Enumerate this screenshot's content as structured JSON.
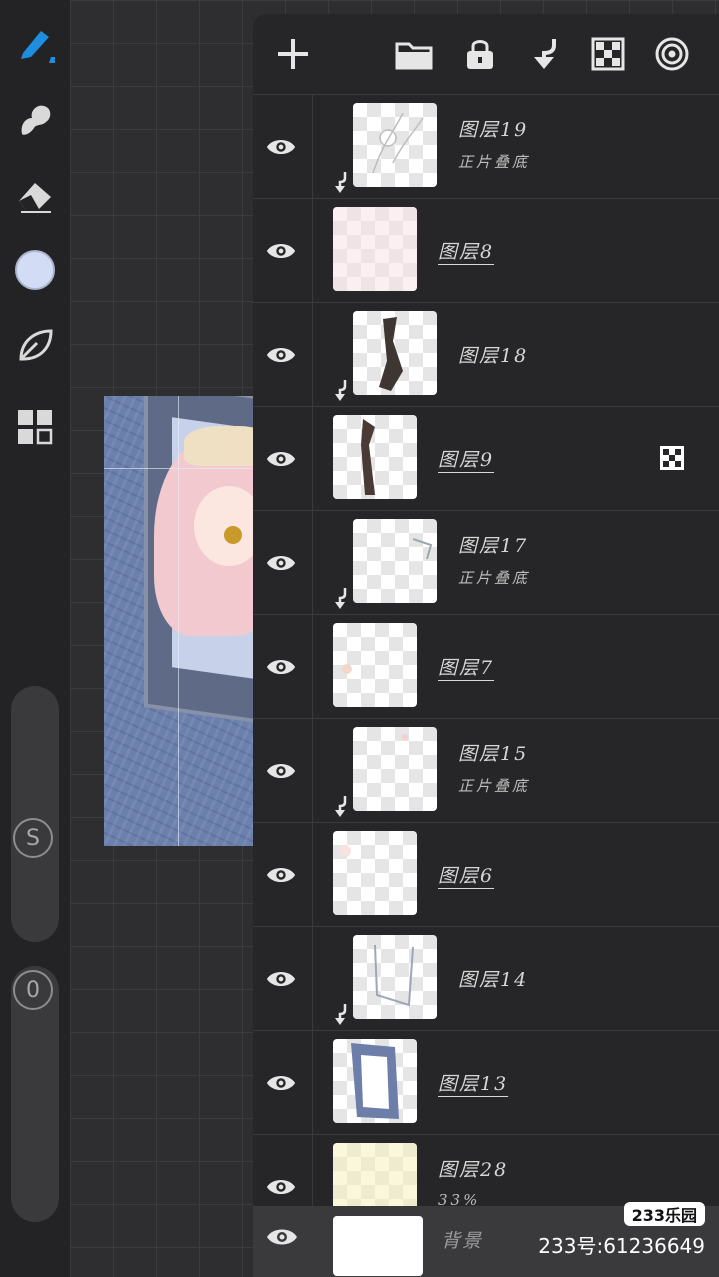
{
  "toolbar": {
    "tools": [
      {
        "icon": "brush-pen-icon",
        "active": true
      },
      {
        "icon": "smudge-icon"
      },
      {
        "icon": "eraser-icon"
      },
      {
        "icon": "color-swatch-icon"
      },
      {
        "icon": "leaf-icon"
      },
      {
        "icon": "layers-grid-icon"
      }
    ],
    "size_knob_label": "S",
    "opacity_knob_label": "0",
    "color": "#d3dcf5"
  },
  "panel": {
    "header_icons": [
      "add-layer-icon",
      "folder-icon",
      "lock-icon",
      "clip-mask-icon",
      "alpha-lock-icon",
      "target-icon"
    ]
  },
  "layers": [
    {
      "name": "图层19",
      "subtitle": "正片叠底",
      "clipped": true,
      "underlined": false
    },
    {
      "name": "图层8",
      "subtitle": "",
      "clipped": false,
      "underlined": true
    },
    {
      "name": "图层18",
      "subtitle": "",
      "clipped": true,
      "underlined": false
    },
    {
      "name": "图层9",
      "subtitle": "",
      "clipped": false,
      "underlined": true,
      "badge": "checker-icon"
    },
    {
      "name": "图层17",
      "subtitle": "正片叠底",
      "clipped": true,
      "underlined": false
    },
    {
      "name": "图层7",
      "subtitle": "",
      "clipped": false,
      "underlined": true
    },
    {
      "name": "图层15",
      "subtitle": "正片叠底",
      "clipped": true,
      "underlined": false
    },
    {
      "name": "图层6",
      "subtitle": "",
      "clipped": false,
      "underlined": true
    },
    {
      "name": "图层14",
      "subtitle": "",
      "clipped": true,
      "underlined": false
    },
    {
      "name": "图层13",
      "subtitle": "",
      "clipped": false,
      "underlined": true
    },
    {
      "name": "图层28",
      "subtitle": "33%",
      "clipped": false,
      "underlined": false
    }
  ],
  "background_layer": {
    "name": "背景"
  },
  "watermark": {
    "logo": "233乐园",
    "id": "233号:61236649"
  }
}
